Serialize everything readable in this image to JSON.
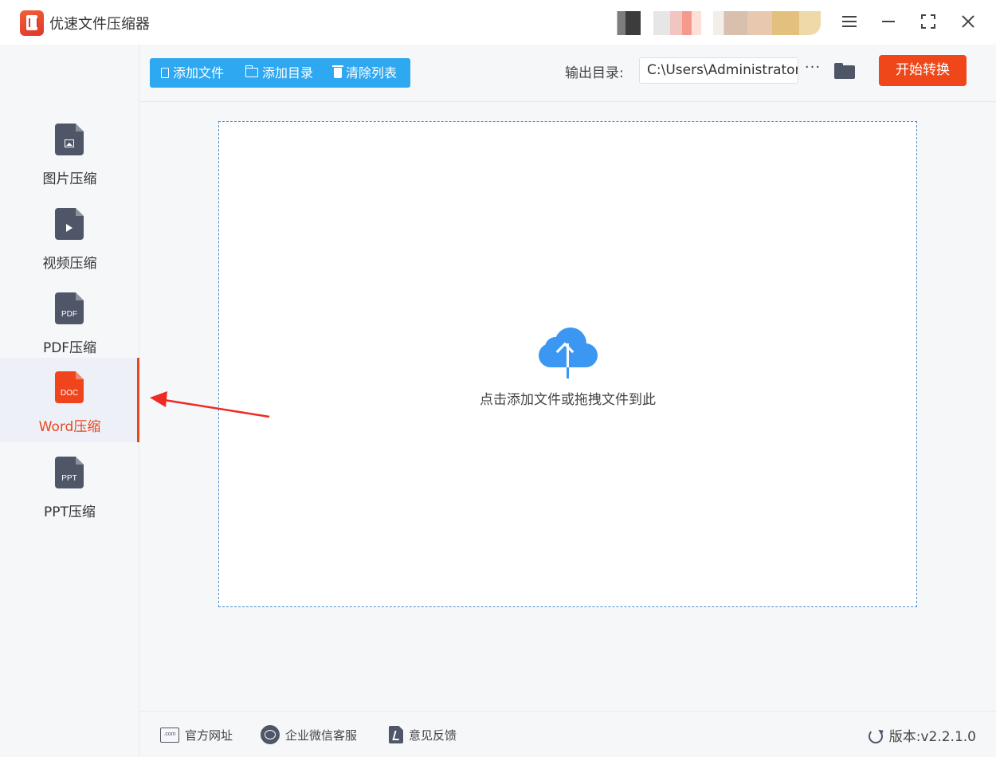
{
  "app": {
    "title": "优速文件压缩器"
  },
  "sidebar": {
    "items": [
      {
        "label": "图片压缩",
        "icon": "image-file-icon",
        "active": false
      },
      {
        "label": "视频压缩",
        "icon": "video-file-icon",
        "active": false
      },
      {
        "label": "PDF压缩",
        "icon": "pdf-file-icon",
        "tag": "PDF",
        "active": false
      },
      {
        "label": "Word压缩",
        "icon": "doc-file-icon",
        "tag": "DOC",
        "active": true
      },
      {
        "label": "PPT压缩",
        "icon": "ppt-file-icon",
        "tag": "PPT",
        "active": false
      }
    ]
  },
  "toolbar": {
    "add_file": "添加文件",
    "add_dir": "添加目录",
    "clear_list": "清除列表",
    "output_label": "输出目录:",
    "output_path": "C:\\Users\\Administrator\\",
    "more": "···",
    "start": "开始转换"
  },
  "drop": {
    "text": "点击添加文件或拖拽文件到此"
  },
  "footer": {
    "website": "官方网址",
    "website_icon_text": ".com",
    "wechat": "企业微信客服",
    "feedback": "意见反馈",
    "version": "版本:v2.2.1.0"
  },
  "colors": {
    "accent_blue": "#2ea8f1",
    "accent_red": "#ef4719",
    "active_orange": "#e9461e",
    "icon_dark": "#4f5668",
    "cloud_blue": "#3b97f2"
  }
}
